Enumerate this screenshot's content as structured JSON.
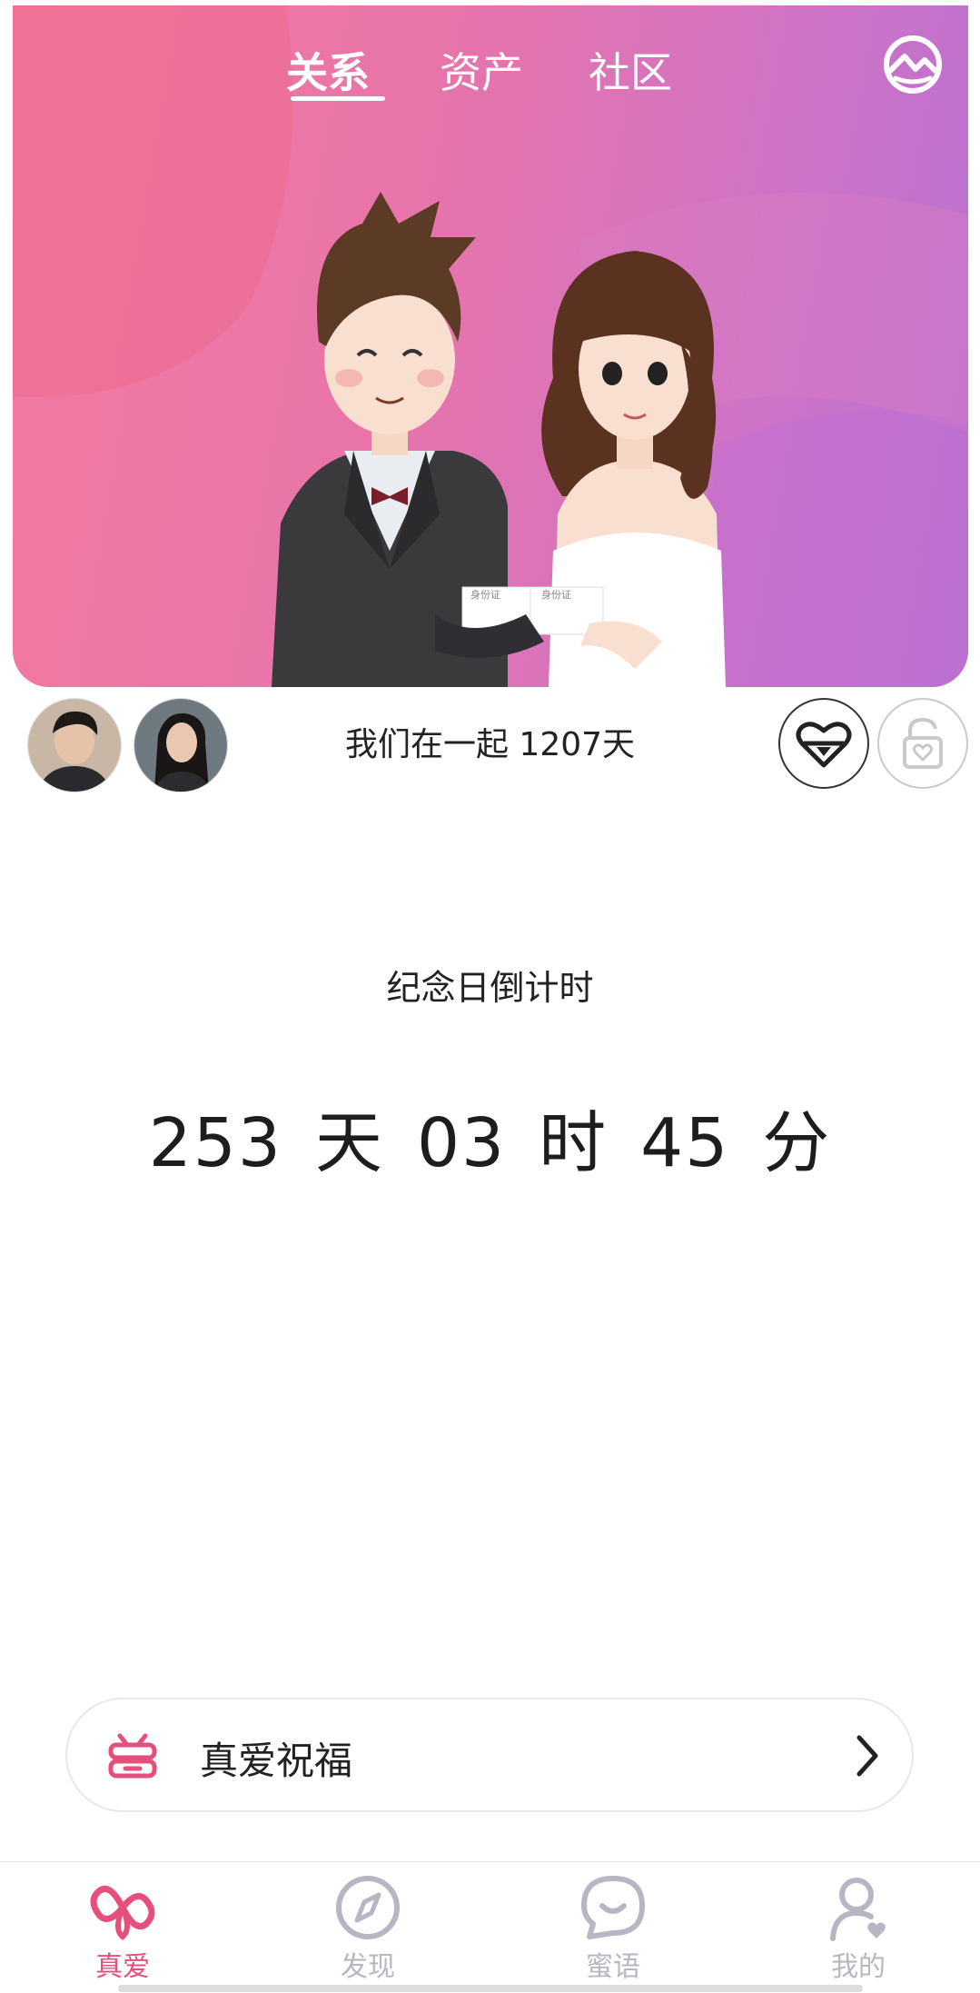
{
  "header": {
    "tabs": [
      {
        "label": "关系",
        "active": true
      },
      {
        "label": "资产",
        "active": false
      },
      {
        "label": "社区",
        "active": false
      }
    ],
    "album_icon": "mountain-photo-icon"
  },
  "hero": {
    "id_card_left": "身份证",
    "id_card_right": "身份证"
  },
  "relationship": {
    "together_text": "我们在一起  1207天",
    "heart_button_icon": "heart-lock-icon",
    "lock_button_icon": "unlock-heart-icon"
  },
  "countdown": {
    "title": "纪念日倒计时",
    "days": "253",
    "days_unit": "天",
    "hours": "03",
    "hours_unit": "时",
    "minutes": "45",
    "minutes_unit": "分"
  },
  "blessing": {
    "label": "真爱祝福",
    "icon": "gift-ribbon-icon",
    "chevron": "chevron-right-icon"
  },
  "nav": {
    "items": [
      {
        "label": "真爱",
        "icon": "infinity-heart-icon",
        "active": true
      },
      {
        "label": "发现",
        "icon": "compass-icon",
        "active": false
      },
      {
        "label": "蜜语",
        "icon": "chat-smile-icon",
        "active": false
      },
      {
        "label": "我的",
        "icon": "user-heart-icon",
        "active": false
      }
    ]
  },
  "colors": {
    "accent": "#e64f7c",
    "hero_gradient_start": "#f47aa0",
    "hero_gradient_end": "#b671d3",
    "inactive_nav": "#b7b7c4"
  }
}
